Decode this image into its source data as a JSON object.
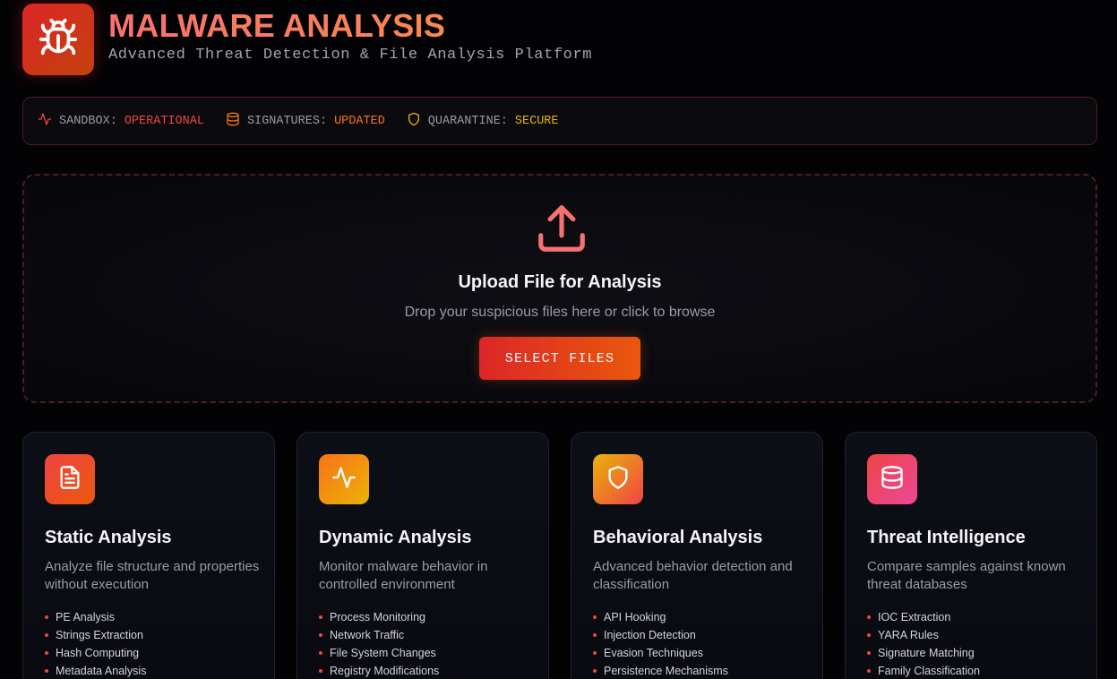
{
  "header": {
    "title": "MALWARE ANALYSIS",
    "subtitle": "Advanced Threat Detection & File Analysis Platform",
    "logo_icon": "bug-icon"
  },
  "status": [
    {
      "key": "SANDBOX:",
      "value": "OPERATIONAL",
      "icon": "activity-icon",
      "color": "#ef4444"
    },
    {
      "key": "SIGNATURES:",
      "value": "UPDATED",
      "icon": "database-icon",
      "color": "#f97316"
    },
    {
      "key": "QUARANTINE:",
      "value": "SECURE",
      "icon": "shield-icon",
      "color": "#eab308"
    }
  ],
  "upload": {
    "icon": "upload-icon",
    "title": "Upload File for Analysis",
    "description": "Drop your suspicious files here or click to browse",
    "button_label": "SELECT FILES"
  },
  "cards": [
    {
      "title": "Static Analysis",
      "description": "Analyze file structure and properties without execution",
      "icon": "file-text-icon",
      "items": [
        "PE Analysis",
        "Strings Extraction",
        "Hash Computing",
        "Metadata Analysis"
      ]
    },
    {
      "title": "Dynamic Analysis",
      "description": "Monitor malware behavior in controlled environment",
      "icon": "activity-icon",
      "items": [
        "Process Monitoring",
        "Network Traffic",
        "File System Changes",
        "Registry Modifications"
      ]
    },
    {
      "title": "Behavioral Analysis",
      "description": "Advanced behavior detection and classification",
      "icon": "shield-icon",
      "items": [
        "API Hooking",
        "Injection Detection",
        "Evasion Techniques",
        "Persistence Mechanisms"
      ]
    },
    {
      "title": "Threat Intelligence",
      "description": "Compare samples against known threat databases",
      "icon": "database-icon",
      "items": [
        "IOC Extraction",
        "YARA Rules",
        "Signature Matching",
        "Family Classification"
      ]
    }
  ],
  "colors": {
    "accent_red": "#ef4444",
    "accent_orange": "#f97316",
    "accent_yellow": "#eab308",
    "accent_pink": "#ec4899"
  }
}
